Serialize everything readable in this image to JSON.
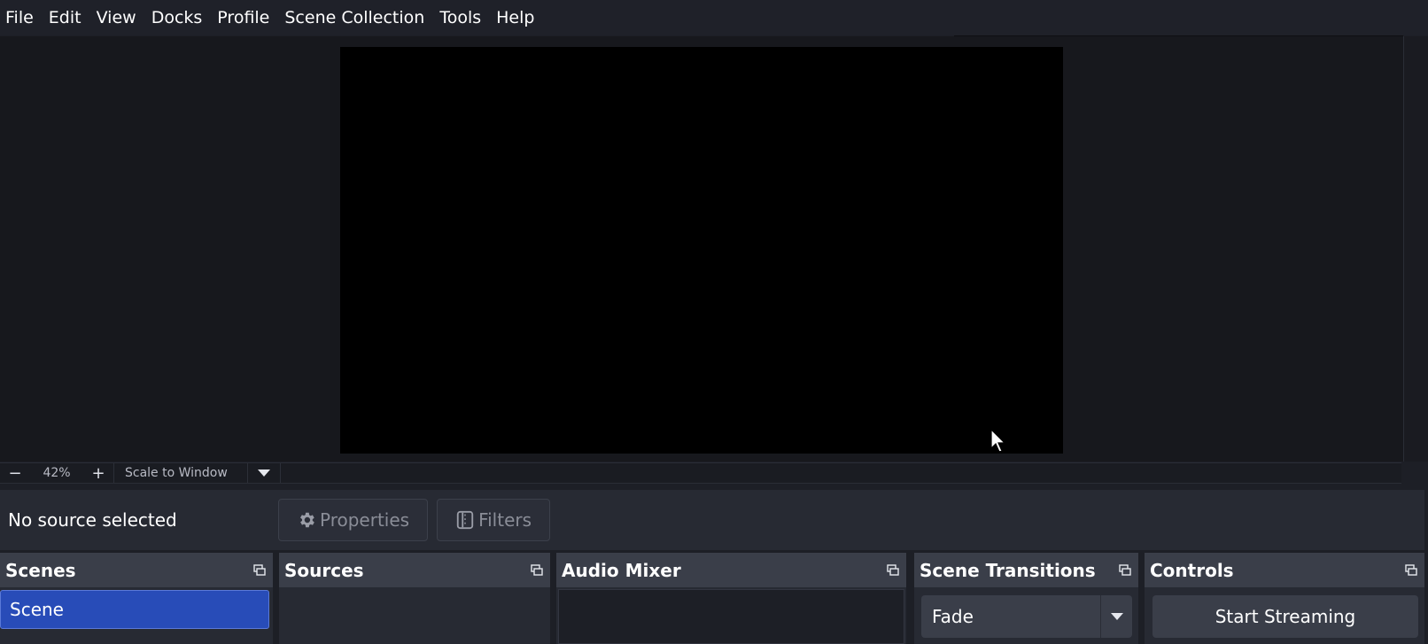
{
  "menu": [
    "File",
    "Edit",
    "View",
    "Docks",
    "Profile",
    "Scene Collection",
    "Tools",
    "Help"
  ],
  "zoombar": {
    "zoom_out": "−",
    "zoom_level": "42%",
    "zoom_in": "+",
    "scale_mode": "Scale to Window"
  },
  "context": {
    "no_source": "No source selected",
    "properties_label": "Properties",
    "filters_label": "Filters"
  },
  "docks": {
    "scenes": {
      "title": "Scenes",
      "items": [
        "Scene"
      ]
    },
    "sources": {
      "title": "Sources"
    },
    "audio_mixer": {
      "title": "Audio Mixer"
    },
    "scene_transitions": {
      "title": "Scene Transitions",
      "selected": "Fade"
    },
    "controls": {
      "title": "Controls",
      "start_streaming": "Start Streaming"
    }
  },
  "colors": {
    "accent_selected": "#284cb8",
    "background": "#1d1f26",
    "panel": "#272a33",
    "header": "#3a3e49"
  },
  "icons": {
    "properties": "gear-icon",
    "filters": "filter-icon",
    "dock_undock": "float-icon",
    "dropdown": "chevron-down-icon"
  }
}
